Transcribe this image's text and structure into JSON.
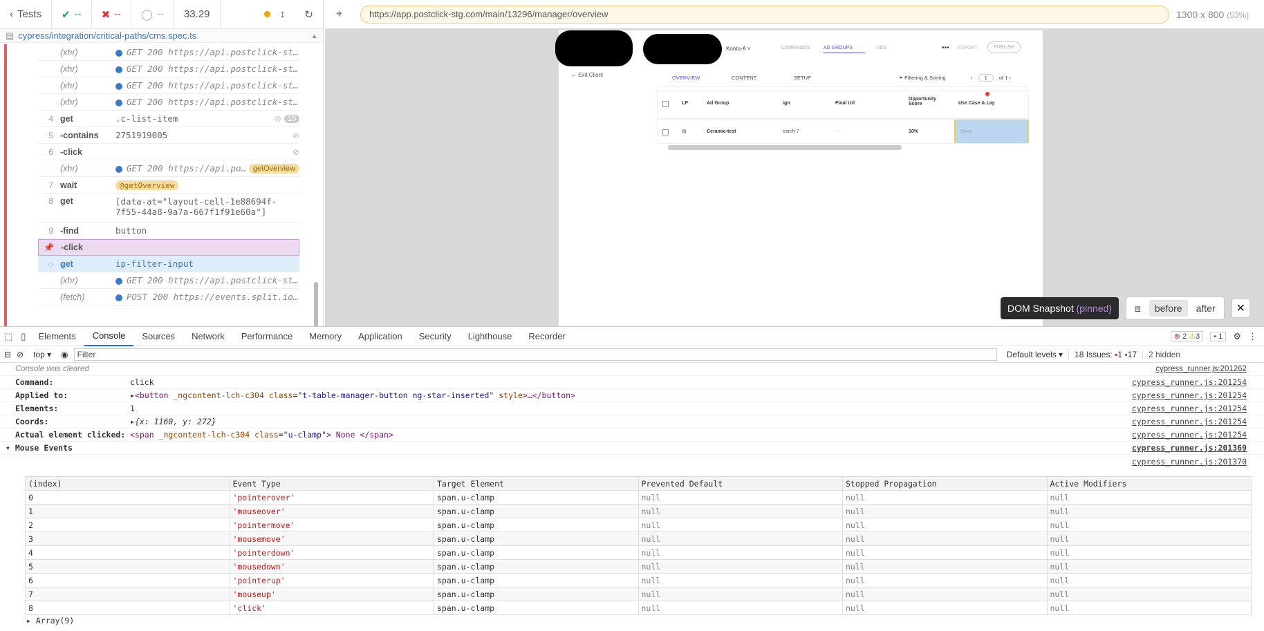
{
  "reporter": {
    "back": "Tests",
    "passed": "--",
    "failed": "--",
    "pending": "--",
    "duration": "33.29",
    "spec": "cypress/integration/critical-paths/cms.spec.ts",
    "commands": [
      {
        "num": "",
        "name": "(xhr)",
        "msg": "GET 200 https://api.postclick-st...",
        "xhr": true
      },
      {
        "num": "",
        "name": "(xhr)",
        "msg": "GET 200 https://api.postclick-st...",
        "xhr": true
      },
      {
        "num": "",
        "name": "(xhr)",
        "msg": "GET 200 https://api.postclick-st...",
        "xhr": true
      },
      {
        "num": "",
        "name": "(xhr)",
        "msg": "GET 200 https://api.postclick-st...",
        "xhr": true
      },
      {
        "num": "4",
        "name": "get",
        "msg": ".c-list-item",
        "count": "15"
      },
      {
        "num": "5",
        "name": "-contains",
        "msg": "2751919005"
      },
      {
        "num": "6",
        "name": "-click",
        "msg": ""
      },
      {
        "num": "",
        "name": "(xhr)",
        "msg": "GET 200 https://api.postcl...",
        "xhr": true,
        "alias": "getOverview"
      },
      {
        "num": "7",
        "name": "wait",
        "msg": "",
        "alias": "@getOverview"
      },
      {
        "num": "8",
        "name": "get",
        "msg": "[data-at=\"layout-cell-1e88694f-7f55-44a8-9a7a-667f1f91e60a\"]"
      },
      {
        "num": "9",
        "name": "-find",
        "msg": "button"
      },
      {
        "num": "",
        "name": "-click",
        "msg": "",
        "pinned": true
      },
      {
        "num": "",
        "name": "get",
        "msg": "ip-filter-input",
        "active": true
      },
      {
        "num": "",
        "name": "(xhr)",
        "msg": "GET 200 https://api.postclick-st...",
        "xhr": true
      },
      {
        "num": "",
        "name": "(fetch)",
        "msg": "POST 200 https://events.split.io...",
        "xhr": true
      }
    ]
  },
  "aut": {
    "url": "https://app.postclick-stg.com/main/13296/manager/overview",
    "viewport": "1300 x 800",
    "scale": "(53%)",
    "app": {
      "account": "Konto-A",
      "tabs": [
        "CAMPAIGNS",
        "AD GROUPS",
        "ADS"
      ],
      "export": "EXPORT",
      "publish": "PUBLISH",
      "exit": "Exit Client",
      "subtabs": [
        "OVERVIEW",
        "CONTENT",
        "SETUP"
      ],
      "filter": "Filtering & Sorting",
      "page": "1",
      "of": "of 1",
      "cols": [
        "LP",
        "Ad Group",
        "ign",
        "Final Url",
        "Opportunity Score",
        "Use Case & Lay"
      ],
      "row": [
        "Ceramic-test",
        "earch-7",
        "- -",
        "10%",
        "None"
      ]
    },
    "snapshot": {
      "label": "DOM Snapshot",
      "pinned": "(pinned)",
      "before": "before",
      "after": "after"
    }
  },
  "devtools": {
    "tabs": [
      "Elements",
      "Console",
      "Sources",
      "Network",
      "Performance",
      "Memory",
      "Application",
      "Security",
      "Lighthouse",
      "Recorder"
    ],
    "errors": "2",
    "warnings": "3",
    "issues_badge": "1",
    "context": "top",
    "filter": "Filter",
    "levels": "Default levels",
    "issues": "18 Issues:",
    "issues_err": "1",
    "issues_info": "17",
    "hidden": "2 hidden",
    "console": {
      "cleared": "Console was cleared",
      "src1": "cypress_runner.js:201262",
      "command_k": "Command:",
      "command_v": "click",
      "applied_k": "Applied to:",
      "applied_tag": "button",
      "applied_attr1": "_ngcontent-lch-c304",
      "applied_attr2": "class",
      "applied_val2": "\"t-table-manager-button ng-star-inserted\"",
      "applied_attr3": "style",
      "applied_rest": ">…</button>",
      "elements_k": "Elements:",
      "elements_v": "1",
      "coords_k": "Coords:",
      "coords_v": "{x: 1160, y: 272}",
      "actual_k": "Actual element clicked:",
      "actual_tag": "span",
      "actual_attr1": "_ngcontent-lch-c304",
      "actual_attr2": "class",
      "actual_val2": "\"u-clamp\"",
      "actual_text": "> None </span>",
      "src2": "cypress_runner.js:201254",
      "mouse_k": "Mouse Events",
      "src3": "cypress_runner.js:201369",
      "src4": "cypress_runner.js:201370",
      "array": "Array(9)",
      "headers": [
        "(index)",
        "Event Type",
        "Target Element",
        "Prevented Default",
        "Stopped Propagation",
        "Active Modifiers"
      ],
      "rows": [
        [
          "0",
          "'pointerover'"
        ],
        [
          "1",
          "'mouseover'"
        ],
        [
          "2",
          "'pointermove'"
        ],
        [
          "3",
          "'mousemove'"
        ],
        [
          "4",
          "'pointerdown'"
        ],
        [
          "5",
          "'mousedown'"
        ],
        [
          "6",
          "'pointerup'"
        ],
        [
          "7",
          "'mouseup'"
        ],
        [
          "8",
          "'click'"
        ]
      ],
      "target": "span.u-clamp",
      "null": "null"
    }
  }
}
